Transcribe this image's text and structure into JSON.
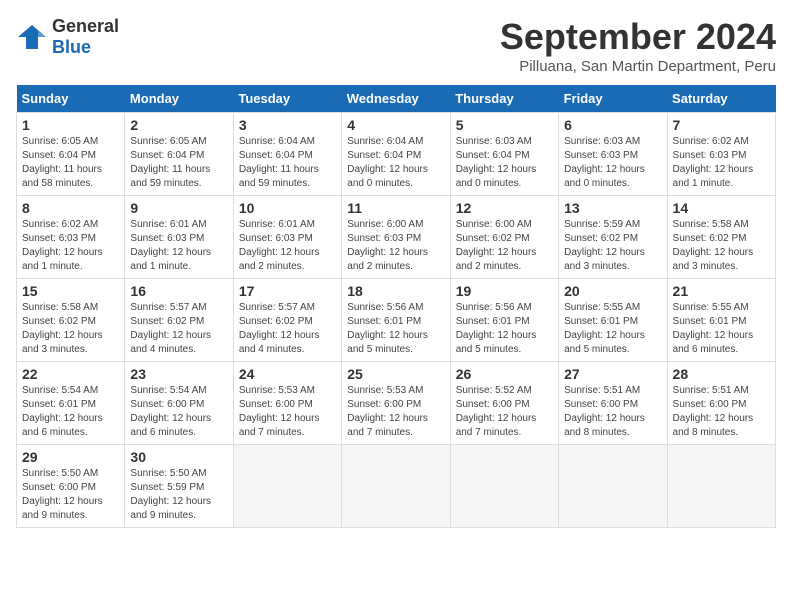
{
  "logo": {
    "general": "General",
    "blue": "Blue"
  },
  "title": "September 2024",
  "location": "Pilluana, San Martin Department, Peru",
  "days_header": [
    "Sunday",
    "Monday",
    "Tuesday",
    "Wednesday",
    "Thursday",
    "Friday",
    "Saturday"
  ],
  "weeks": [
    [
      {
        "num": "1",
        "info": "Sunrise: 6:05 AM\nSunset: 6:04 PM\nDaylight: 11 hours\nand 58 minutes."
      },
      {
        "num": "2",
        "info": "Sunrise: 6:05 AM\nSunset: 6:04 PM\nDaylight: 11 hours\nand 59 minutes."
      },
      {
        "num": "3",
        "info": "Sunrise: 6:04 AM\nSunset: 6:04 PM\nDaylight: 11 hours\nand 59 minutes."
      },
      {
        "num": "4",
        "info": "Sunrise: 6:04 AM\nSunset: 6:04 PM\nDaylight: 12 hours\nand 0 minutes."
      },
      {
        "num": "5",
        "info": "Sunrise: 6:03 AM\nSunset: 6:04 PM\nDaylight: 12 hours\nand 0 minutes."
      },
      {
        "num": "6",
        "info": "Sunrise: 6:03 AM\nSunset: 6:03 PM\nDaylight: 12 hours\nand 0 minutes."
      },
      {
        "num": "7",
        "info": "Sunrise: 6:02 AM\nSunset: 6:03 PM\nDaylight: 12 hours\nand 1 minute."
      }
    ],
    [
      {
        "num": "8",
        "info": "Sunrise: 6:02 AM\nSunset: 6:03 PM\nDaylight: 12 hours\nand 1 minute."
      },
      {
        "num": "9",
        "info": "Sunrise: 6:01 AM\nSunset: 6:03 PM\nDaylight: 12 hours\nand 1 minute."
      },
      {
        "num": "10",
        "info": "Sunrise: 6:01 AM\nSunset: 6:03 PM\nDaylight: 12 hours\nand 2 minutes."
      },
      {
        "num": "11",
        "info": "Sunrise: 6:00 AM\nSunset: 6:03 PM\nDaylight: 12 hours\nand 2 minutes."
      },
      {
        "num": "12",
        "info": "Sunrise: 6:00 AM\nSunset: 6:02 PM\nDaylight: 12 hours\nand 2 minutes."
      },
      {
        "num": "13",
        "info": "Sunrise: 5:59 AM\nSunset: 6:02 PM\nDaylight: 12 hours\nand 3 minutes."
      },
      {
        "num": "14",
        "info": "Sunrise: 5:58 AM\nSunset: 6:02 PM\nDaylight: 12 hours\nand 3 minutes."
      }
    ],
    [
      {
        "num": "15",
        "info": "Sunrise: 5:58 AM\nSunset: 6:02 PM\nDaylight: 12 hours\nand 3 minutes."
      },
      {
        "num": "16",
        "info": "Sunrise: 5:57 AM\nSunset: 6:02 PM\nDaylight: 12 hours\nand 4 minutes."
      },
      {
        "num": "17",
        "info": "Sunrise: 5:57 AM\nSunset: 6:02 PM\nDaylight: 12 hours\nand 4 minutes."
      },
      {
        "num": "18",
        "info": "Sunrise: 5:56 AM\nSunset: 6:01 PM\nDaylight: 12 hours\nand 5 minutes."
      },
      {
        "num": "19",
        "info": "Sunrise: 5:56 AM\nSunset: 6:01 PM\nDaylight: 12 hours\nand 5 minutes."
      },
      {
        "num": "20",
        "info": "Sunrise: 5:55 AM\nSunset: 6:01 PM\nDaylight: 12 hours\nand 5 minutes."
      },
      {
        "num": "21",
        "info": "Sunrise: 5:55 AM\nSunset: 6:01 PM\nDaylight: 12 hours\nand 6 minutes."
      }
    ],
    [
      {
        "num": "22",
        "info": "Sunrise: 5:54 AM\nSunset: 6:01 PM\nDaylight: 12 hours\nand 6 minutes."
      },
      {
        "num": "23",
        "info": "Sunrise: 5:54 AM\nSunset: 6:00 PM\nDaylight: 12 hours\nand 6 minutes."
      },
      {
        "num": "24",
        "info": "Sunrise: 5:53 AM\nSunset: 6:00 PM\nDaylight: 12 hours\nand 7 minutes."
      },
      {
        "num": "25",
        "info": "Sunrise: 5:53 AM\nSunset: 6:00 PM\nDaylight: 12 hours\nand 7 minutes."
      },
      {
        "num": "26",
        "info": "Sunrise: 5:52 AM\nSunset: 6:00 PM\nDaylight: 12 hours\nand 7 minutes."
      },
      {
        "num": "27",
        "info": "Sunrise: 5:51 AM\nSunset: 6:00 PM\nDaylight: 12 hours\nand 8 minutes."
      },
      {
        "num": "28",
        "info": "Sunrise: 5:51 AM\nSunset: 6:00 PM\nDaylight: 12 hours\nand 8 minutes."
      }
    ],
    [
      {
        "num": "29",
        "info": "Sunrise: 5:50 AM\nSunset: 6:00 PM\nDaylight: 12 hours\nand 9 minutes."
      },
      {
        "num": "30",
        "info": "Sunrise: 5:50 AM\nSunset: 5:59 PM\nDaylight: 12 hours\nand 9 minutes."
      },
      {
        "num": "",
        "info": ""
      },
      {
        "num": "",
        "info": ""
      },
      {
        "num": "",
        "info": ""
      },
      {
        "num": "",
        "info": ""
      },
      {
        "num": "",
        "info": ""
      }
    ]
  ]
}
